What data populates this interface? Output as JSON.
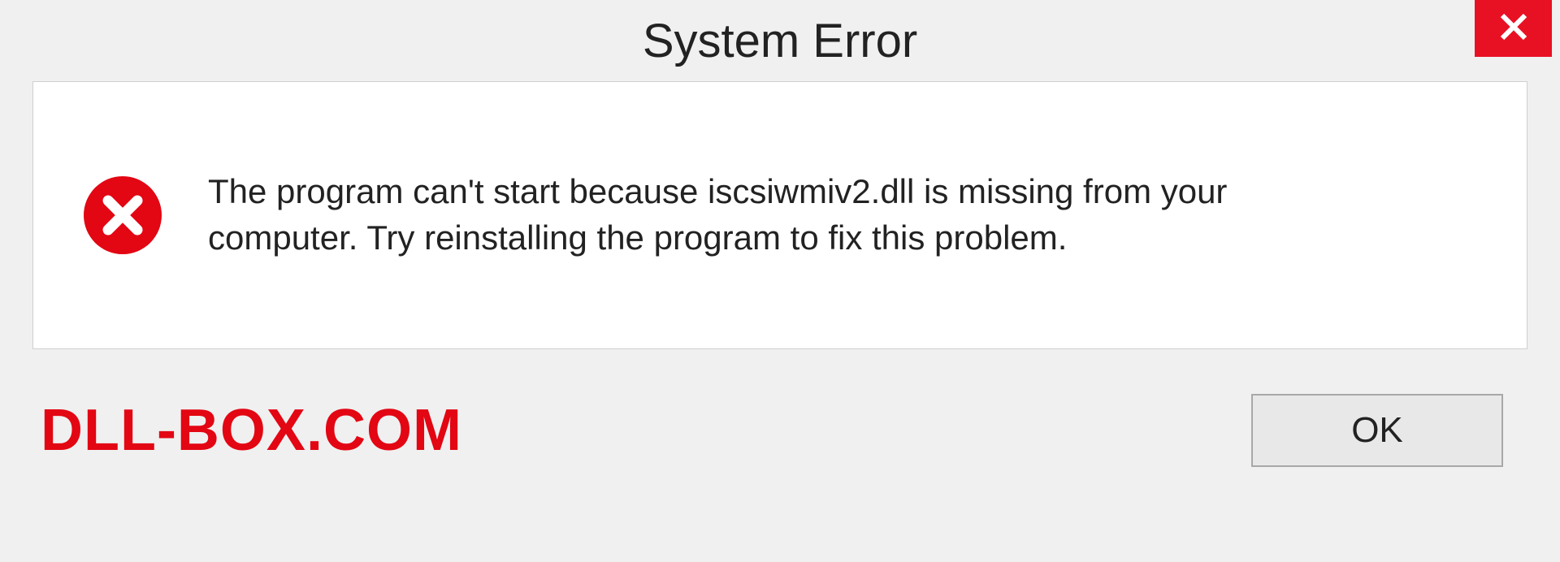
{
  "dialog": {
    "title": "System Error",
    "message": "The program can't start because iscsiwmiv2.dll is missing from your computer. Try reinstalling the program to fix this problem.",
    "ok_label": "OK"
  },
  "brand": "DLL-BOX.COM",
  "colors": {
    "close_bg": "#e81123",
    "error_red": "#e30613",
    "brand_red": "#e30613"
  }
}
